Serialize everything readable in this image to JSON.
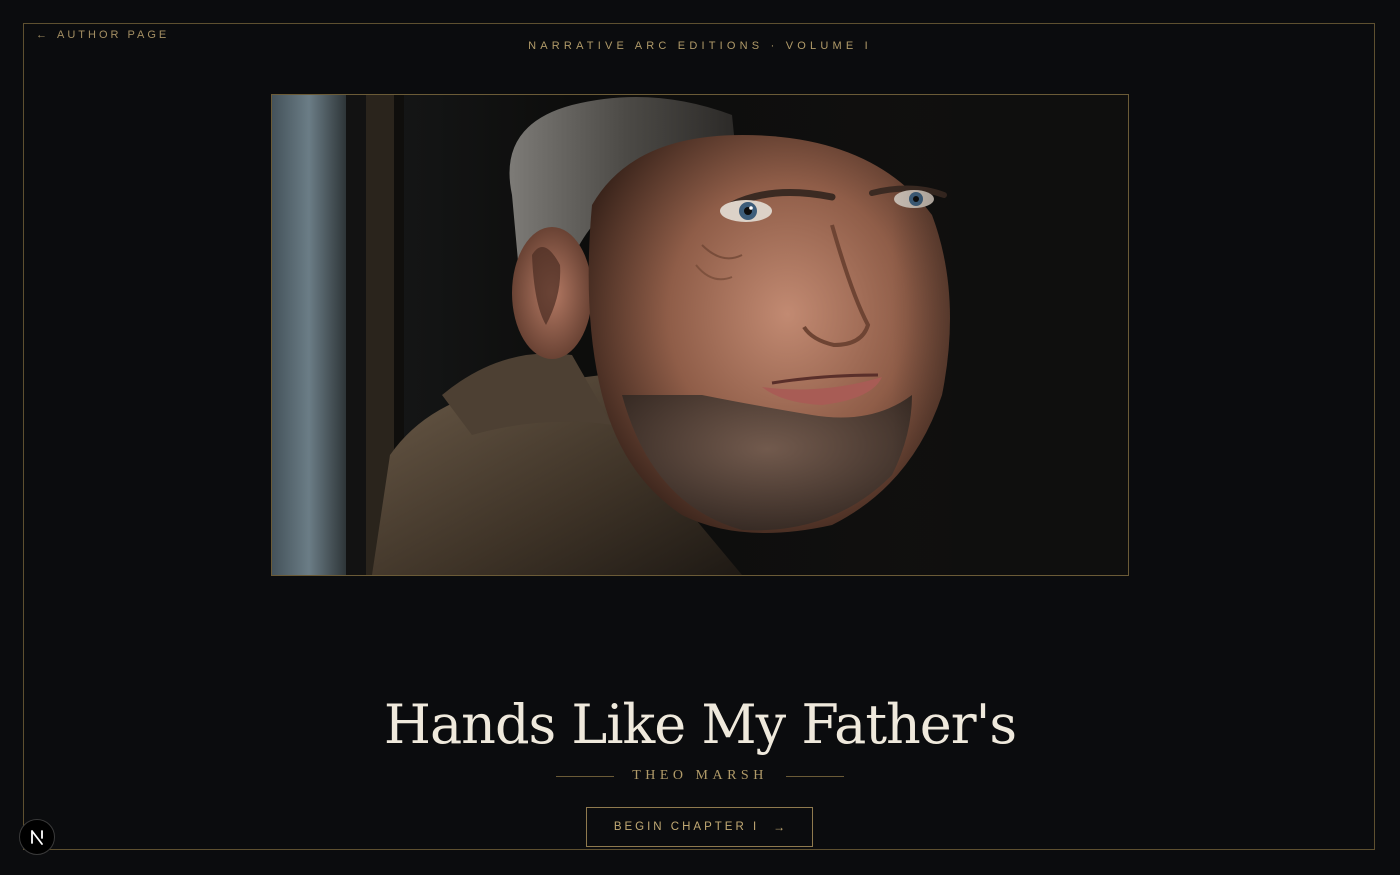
{
  "nav": {
    "back_arrow": "←",
    "back_label": "AUTHOR PAGE"
  },
  "header": {
    "edition": "NARRATIVE ARC EDITIONS · VOLUME I"
  },
  "hero": {
    "image_subject": "portrait of a smiling bearded man in a dark jacket"
  },
  "book": {
    "title": "Hands Like My Father's",
    "author": "THEO MARSH"
  },
  "cta": {
    "label": "BEGIN CHAPTER I",
    "arrow": "→"
  },
  "icons": {
    "back": "arrow-left-icon",
    "cta": "arrow-right-icon",
    "badge": "nextjs-logo-icon"
  },
  "colors": {
    "background": "#0b0c0e",
    "accent_gold": "#b19b69",
    "title_ivory": "#efe9dc",
    "frame_border": "#5e5030"
  }
}
